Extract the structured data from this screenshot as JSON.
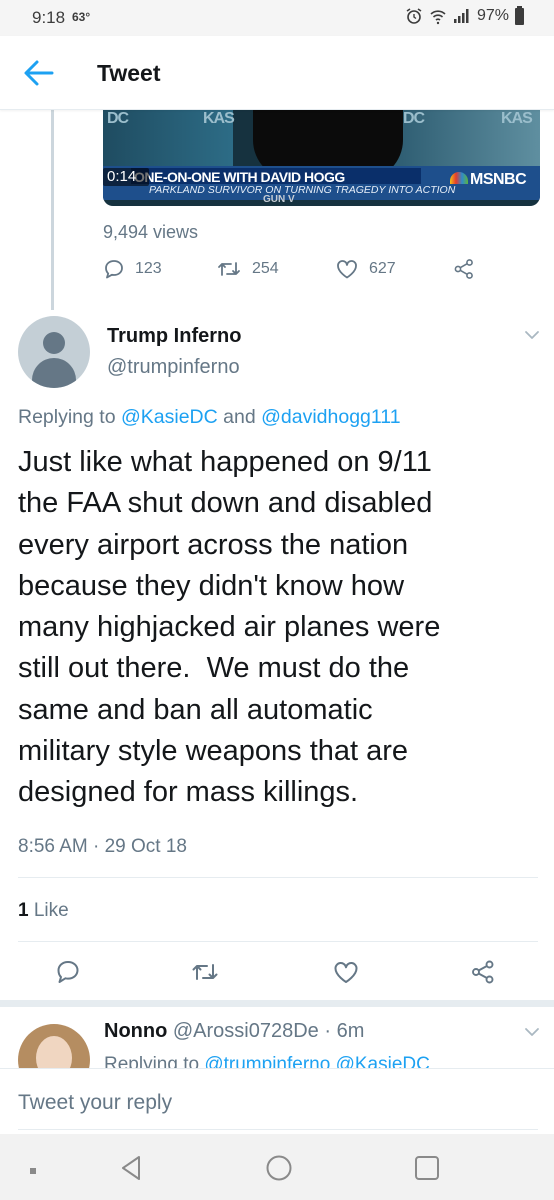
{
  "status_bar": {
    "time": "9:18",
    "temperature": "63°",
    "battery": "97%"
  },
  "header": {
    "title": "Tweet"
  },
  "quoted_video": {
    "duration": "0:14",
    "headline": "ONE-ON-ONE WITH DAVID HOGG",
    "subline": "PARKLAND SURVIVOR ON TURNING TRAGEDY INTO ACTION",
    "network": "MSNBC",
    "studio_text_left": "DC",
    "studio_text_mid": "KAS",
    "studio_text_right": "DC",
    "studio_text_far": "KAS",
    "ticker": "GUN V"
  },
  "parent_tweet": {
    "views": "9,494 views",
    "replies": "123",
    "retweets": "254",
    "likes": "627"
  },
  "tweet": {
    "display_name": "Trump Inferno",
    "handle": "@trumpinferno",
    "replying_prefix": "Replying to ",
    "replying_user1": "@KasieDC",
    "replying_and": " and ",
    "replying_user2": "@davidhogg111",
    "text": "Just like what happened on 9/11\nthe FAA shut down and disabled\nevery airport across the nation\nbecause they didn't know how\nmany highjacked air planes were\nstill out there.  We must do the\nsame and ban all automatic\nmilitary style weapons that are\ndesigned for mass killings.",
    "timestamp": "8:56 AM · 29 Oct 18",
    "like_count": "1",
    "like_label": " Like"
  },
  "reply": {
    "name": "Nonno",
    "handle": "@Arossi0728De",
    "time": " · 6m",
    "replying_prefix": "Replying to ",
    "replying_users": "@trumpinferno @KasieDC"
  },
  "compose": {
    "placeholder": "Tweet your reply"
  },
  "colors": {
    "accent": "#1da1f2",
    "secondary_text": "#657786",
    "primary_text": "#14171a",
    "divider": "#e6ecf0"
  },
  "icons": {
    "back": "arrow-left-icon",
    "reply": "speech-bubble-icon",
    "retweet": "retweet-icon",
    "like": "heart-icon",
    "share": "share-icon",
    "caret": "chevron-down-icon"
  }
}
